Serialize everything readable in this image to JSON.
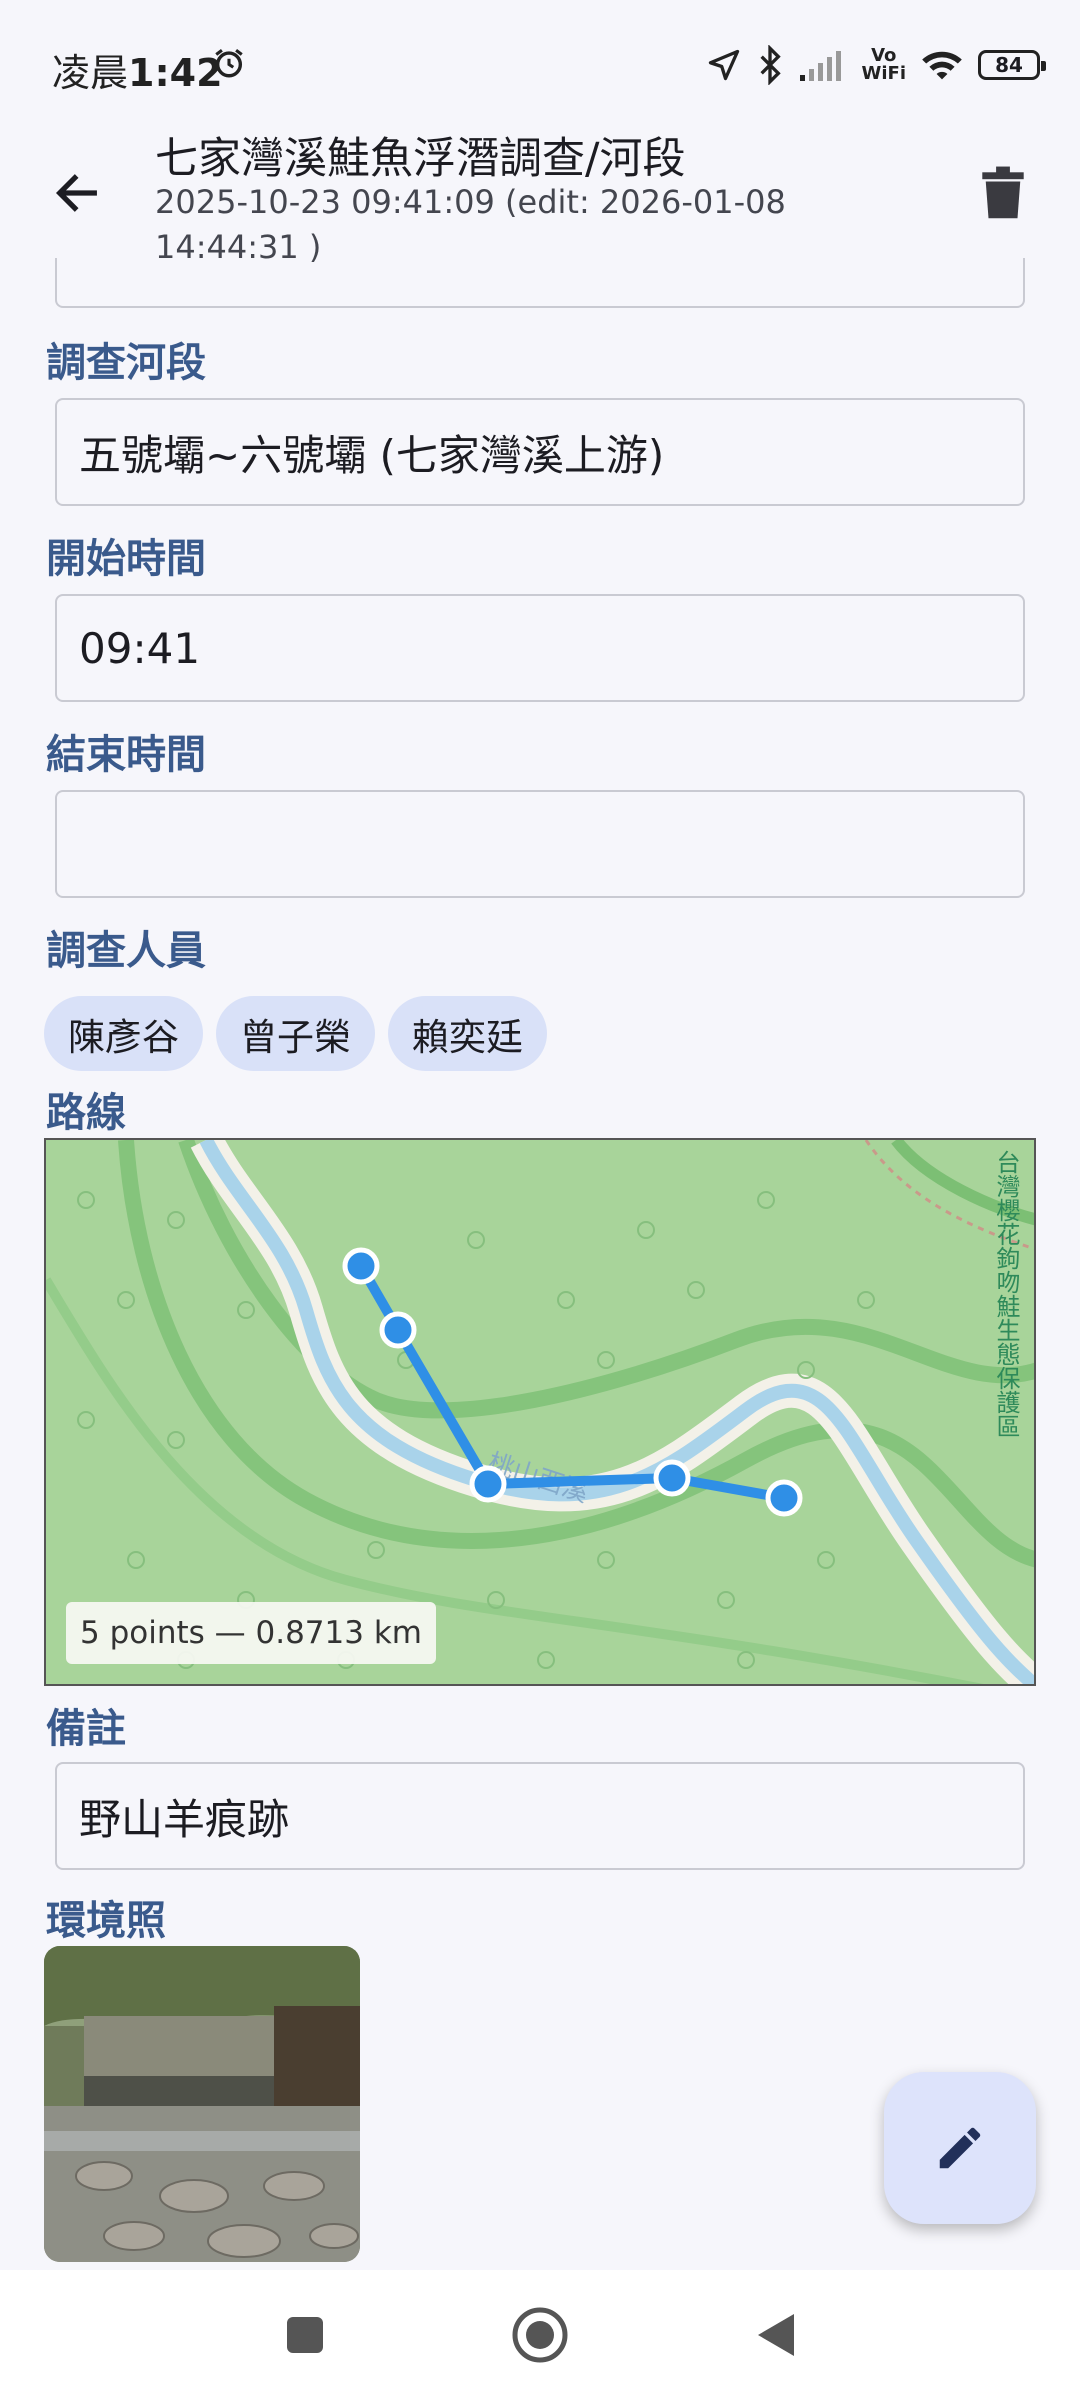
{
  "status_bar": {
    "time_prefix": "凌晨",
    "time": "1:42",
    "vowifi_top": "Vo",
    "vowifi_bottom": "WiFi",
    "battery": "84",
    "icons": [
      "alarm-icon",
      "location-arrow-icon",
      "bluetooth-icon",
      "signal-icon",
      "vowifi-icon",
      "wifi-icon",
      "battery-icon"
    ]
  },
  "app_bar": {
    "title": "七家灣溪鮭魚浮潛調查/河段",
    "subtitle": "2025-10-23 09:41:09 (edit: 2026-01-08 14:44:31 )",
    "icons": [
      "back-arrow-icon",
      "trash-icon"
    ]
  },
  "form": {
    "section_label": "調查河段",
    "section_value": "五號壩~六號壩 (七家灣溪上游)",
    "start_label": "開始時間",
    "start_value": "09:41",
    "end_label": "結束時間",
    "end_value": "",
    "surveyors_label": "調查人員",
    "surveyors": [
      "陳彥谷",
      "曾子榮",
      "賴奕廷"
    ],
    "route_label": "路線",
    "route_summary": "5 points — 0.8713 km",
    "notes_label": "備註",
    "notes_value": "野山羊痕跡",
    "photo_label": "環境照"
  },
  "map": {
    "river_label": "桃山西溪",
    "reserve_label": "台灣櫻花鉤吻鮭生態保護區",
    "route_color": "#2f8fe6",
    "point_count": 5
  },
  "colors": {
    "label": "#3a5a8c",
    "chip_bg": "#d9e1f8",
    "fab_bg": "#dde3fb",
    "map_green": "#a8d49a",
    "river": "#a9d3ea"
  },
  "fab": {
    "icon": "pencil-icon"
  },
  "nav_bar": {
    "icons": [
      "recents-square-icon",
      "home-circle-icon",
      "back-triangle-icon"
    ]
  }
}
